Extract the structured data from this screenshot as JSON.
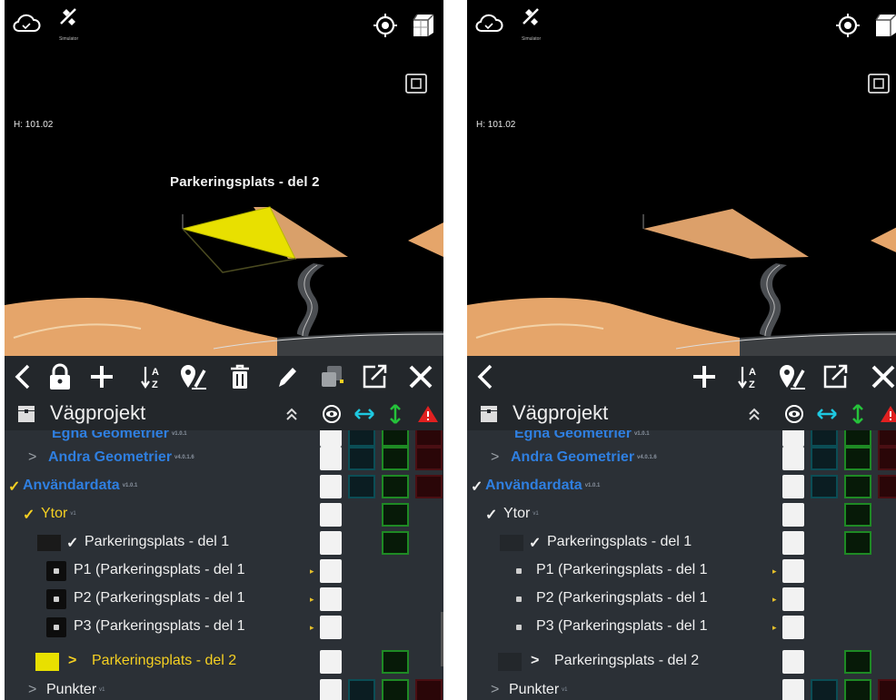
{
  "colors": {
    "blue_text": "#2f7fe0",
    "yellow_text": "#f5d022",
    "white_text": "#f0f0f0",
    "selected_yellow": "#e8e000",
    "surface_tan": "#e5a56a",
    "toolbar_bg": "#23272b",
    "list_bg": "#2b3036"
  },
  "left": {
    "simulator_label": "Simulator",
    "height_readout": "H: 101.02",
    "object_label": "Parkeringsplats - del 2",
    "project_title": "Vägprojekt",
    "toolbar_icons": [
      "chevron-left-icon",
      "lock-icon",
      "plus-icon",
      "sort-az-icon",
      "map-pin-edit-icon",
      "trash-icon",
      "pencil-icon",
      "layers-icon",
      "open-external-icon",
      "close-icon"
    ],
    "rows": {
      "r0": {
        "label": "Egna Geometrier",
        "version": "v1.0.1"
      },
      "r1": {
        "arrow": ">",
        "label": "Andra Geometrier",
        "version": "v4.0.1.6"
      },
      "r2": {
        "arrow": "✓",
        "label": "Användardata",
        "version": "v1.0.1"
      },
      "r3": {
        "arrow": "✓",
        "label": "Ytor",
        "version": "v1"
      },
      "r4": {
        "arrow": "✓",
        "label": "Parkeringsplats - del 1"
      },
      "r5": {
        "label": "P1 (Parkeringsplats - del 1"
      },
      "r6": {
        "label": "P2 (Parkeringsplats - del 1"
      },
      "r7": {
        "label": "P3 (Parkeringsplats - del 1"
      },
      "r8": {
        "arrow": ">",
        "label": "Parkeringsplats - del 2"
      },
      "r9": {
        "arrow": ">",
        "label": "Punkter",
        "version": "v1"
      }
    }
  },
  "right": {
    "simulator_label": "Simulator",
    "height_readout": "H: 101.02",
    "project_title": "Vägprojekt",
    "toolbar_icons": [
      "chevron-left-icon",
      "plus-icon",
      "sort-az-icon",
      "map-pin-edit-icon",
      "open-external-icon",
      "close-icon"
    ],
    "rows": {
      "r0": {
        "label": "Egna Geometrier",
        "version": "v1.0.1"
      },
      "r1": {
        "arrow": ">",
        "label": "Andra Geometrier",
        "version": "v4.0.1.6"
      },
      "r2": {
        "arrow": "✓",
        "label": "Användardata",
        "version": "v1.0.1"
      },
      "r3": {
        "arrow": "✓",
        "label": "Ytor",
        "version": "v1"
      },
      "r4": {
        "arrow": "✓",
        "label": "Parkeringsplats - del 1"
      },
      "r5": {
        "label": "P1 (Parkeringsplats - del 1"
      },
      "r6": {
        "label": "P2 (Parkeringsplats - del 1"
      },
      "r7": {
        "label": "P3 (Parkeringsplats - del 1"
      },
      "r8": {
        "arrow": ">",
        "label": "Parkeringsplats - del 2"
      },
      "r9": {
        "arrow": ">",
        "label": "Punkter",
        "version": "v1"
      }
    }
  }
}
